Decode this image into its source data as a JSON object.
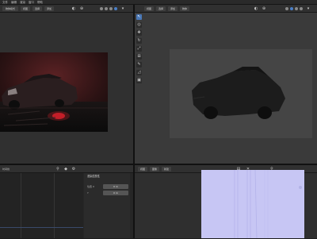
{
  "menu": {
    "items": [
      "文件",
      "编辑",
      "渲染",
      "窗口",
      "帮助"
    ]
  },
  "left_editor": {
    "header_buttons": [
      "物体模式",
      "视图",
      "选择",
      "添加"
    ]
  },
  "right_editor": {
    "header_buttons": [
      "视图",
      "选择",
      "添加",
      "物体"
    ],
    "tools": [
      "select-icon",
      "cursor-icon",
      "move-icon",
      "rotate-icon",
      "scale-icon",
      "transform-icon",
      "annotate-icon",
      "measure-icon",
      "add-cube-icon"
    ]
  },
  "bottom_left": {
    "title": "时间线",
    "panel_title": "渲染层属性",
    "fields": [
      {
        "label": "位置 X",
        "value": "0 m"
      },
      {
        "label": "Y",
        "value": "0 m"
      }
    ]
  },
  "bottom_right": {
    "header_buttons": [
      "视图",
      "图像",
      "新建"
    ]
  },
  "colors": {
    "accent": "#4a78b6",
    "render_red": "#d2202b",
    "uv_fill": "#c7c6f4"
  }
}
